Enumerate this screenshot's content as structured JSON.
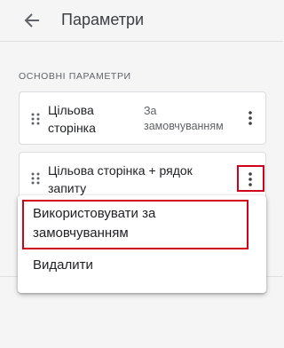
{
  "header": {
    "title": "Параметри",
    "back_icon": "arrow-back-icon"
  },
  "section": {
    "label": "ОСНОВНІ ПАРАМЕТРИ"
  },
  "parameters": [
    {
      "title_line1": "Цільова",
      "title_line2": "сторінка",
      "value_line1": "За",
      "value_line2": "замовчуванням"
    },
    {
      "title_line1": "Цільова сторінка + рядок",
      "title_line2": "запиту"
    }
  ],
  "menu": {
    "items": [
      {
        "line1": "Використовувати за",
        "line2": "замовчуванням"
      },
      {
        "line1": "Видалити"
      }
    ]
  },
  "colors": {
    "highlight": "#d0021b",
    "background": "#f5f5f5",
    "card": "#ffffff"
  }
}
